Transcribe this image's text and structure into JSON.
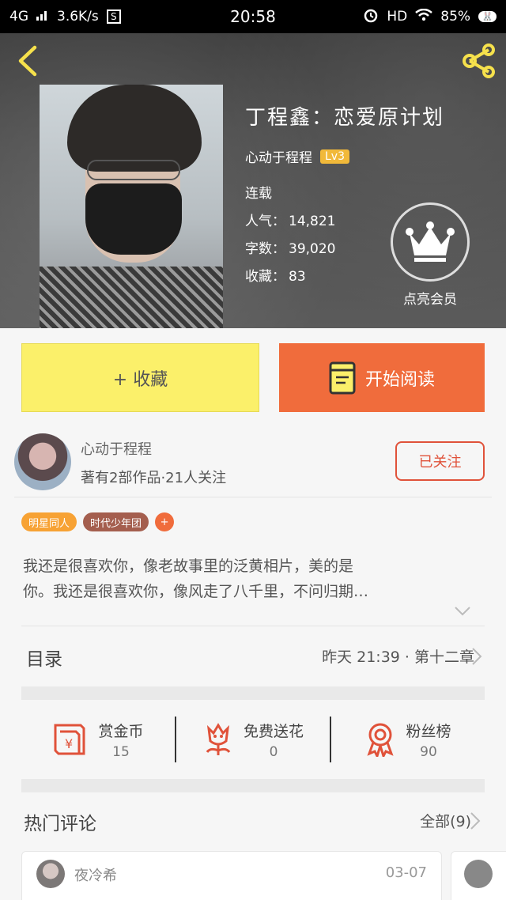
{
  "status_bar": {
    "network": "4G",
    "speed": "3.6K/s",
    "sim_badge": "S",
    "time": "20:58",
    "hd": "HD",
    "battery": "85%"
  },
  "book": {
    "title": "丁程鑫：恋爱原计划",
    "author": "心动于程程",
    "level": "Lv3",
    "status": "连载",
    "popularity_label": "人气：",
    "popularity": "14,821",
    "words_label": "字数：",
    "words": "39,020",
    "favorites_label": "收藏：",
    "favorites": "83"
  },
  "vip": {
    "label": "点亮会员"
  },
  "actions": {
    "collect_label": "+ 收藏",
    "read_label": "开始阅读"
  },
  "author_card": {
    "name": "心动于程程",
    "stats": "著有2部作品·21人关注",
    "follow_label": "已关注"
  },
  "tags": [
    {
      "label": "明星同人"
    },
    {
      "label": "时代少年团"
    },
    {
      "label": "+"
    }
  ],
  "synopsis": {
    "line1": "我还是很喜欢你，像老故事里的泛黄相片，美的是",
    "line2": "你。我还是很喜欢你，像风走了八千里，不问归期…"
  },
  "toc": {
    "title": "目录",
    "latest": "昨天 21:39 · 第十二章"
  },
  "stats": [
    {
      "label": "赏金币",
      "value": "15",
      "icon": "red-envelope-icon"
    },
    {
      "label": "免费送花",
      "value": "0",
      "icon": "flower-icon"
    },
    {
      "label": "粉丝榜",
      "value": "90",
      "icon": "ribbon-medal-icon"
    }
  ],
  "hot_comments": {
    "title": "热门评论",
    "all_label": "全部(9)",
    "items": [
      {
        "name": "夜冷希",
        "date": "03-07"
      }
    ]
  },
  "colors": {
    "accent_orange": "#f06c3c",
    "collect_yellow": "#fbf06a",
    "level_gold": "#f1b93a",
    "stat_icon_red": "#e0523a"
  }
}
